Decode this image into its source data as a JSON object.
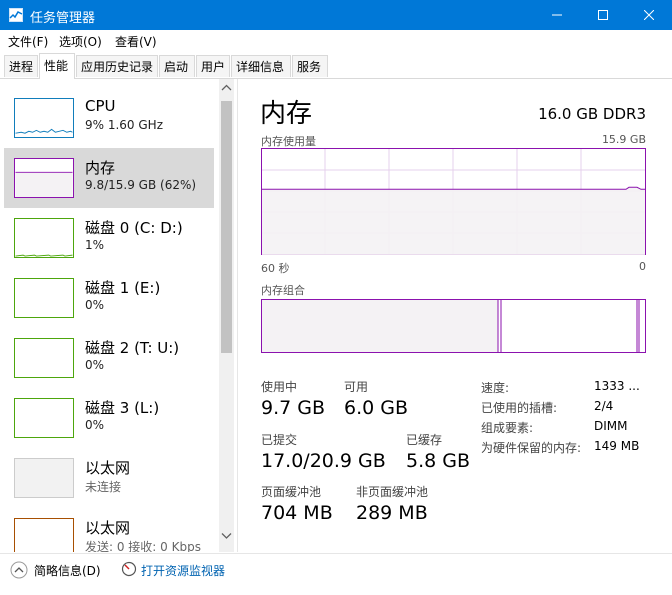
{
  "window": {
    "title": "任务管理器"
  },
  "menu": {
    "items": [
      "文件(F)",
      "选项(O)",
      "查看(V)"
    ]
  },
  "tabs": [
    "进程",
    "性能",
    "应用历史记录",
    "启动",
    "用户",
    "详细信息",
    "服务"
  ],
  "active_tab": 1,
  "sidebar": {
    "items": [
      {
        "name": "CPU",
        "sub": "9%  1.60 GHz",
        "color": "#117dbb"
      },
      {
        "name": "内存",
        "sub": "9.8/15.9 GB (62%)",
        "color": "#8b12ae"
      },
      {
        "name": "磁盘 0 (C: D:)",
        "sub": "1%",
        "color": "#4da60c"
      },
      {
        "name": "磁盘 1 (E:)",
        "sub": "0%",
        "color": "#4da60c"
      },
      {
        "name": "磁盘 2 (T: U:)",
        "sub": "0%",
        "color": "#4da60c"
      },
      {
        "name": "磁盘 3 (L:)",
        "sub": "0%",
        "color": "#4da60c"
      },
      {
        "name": "以太网",
        "sub": "未连接",
        "color": "#cccccc"
      },
      {
        "name": "以太网",
        "sub": "发送: 0 接收: 0 Kbps",
        "color": "#a74f01"
      }
    ]
  },
  "detail": {
    "title": "内存",
    "spec": "16.0 GB DDR3",
    "usage_label": "内存使用量",
    "usage_max": "15.9 GB",
    "axis_left": "60 秒",
    "axis_right": "0",
    "usage_fraction": 0.62,
    "composition_label": "内存组合",
    "stats": {
      "in_use_label": "使用中",
      "in_use": "9.7 GB",
      "available_label": "可用",
      "available": "6.0 GB",
      "committed_label": "已提交",
      "committed": "17.0/20.9 GB",
      "cached_label": "已缓存",
      "cached": "5.8 GB",
      "paged_label": "页面缓冲池",
      "paged": "704 MB",
      "nonpaged_label": "非页面缓冲池",
      "nonpaged": "289 MB"
    },
    "specs": [
      {
        "label": "速度:",
        "value": "1333 ..."
      },
      {
        "label": "已使用的插槽:",
        "value": "2/4"
      },
      {
        "label": "组成要素:",
        "value": "DIMM"
      },
      {
        "label": "为硬件保留的内存:",
        "value": "149 MB"
      }
    ]
  },
  "footer": {
    "summary": "简略信息(D)",
    "monitor": "打开资源监视器"
  },
  "colors": {
    "accent": "#0078d7",
    "memory": "#8b12ae"
  }
}
